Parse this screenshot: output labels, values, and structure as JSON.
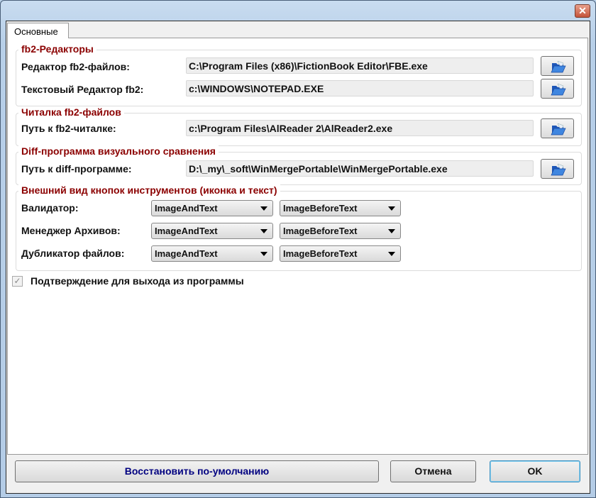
{
  "window": {
    "close_label": "✕"
  },
  "tabs": [
    {
      "label": "Основные"
    }
  ],
  "editors": {
    "title": "fb2-Редакторы",
    "fb2_editor": {
      "label": "Редактор fb2-файлов:",
      "value": "C:\\Program Files (x86)\\FictionBook Editor\\FBE.exe"
    },
    "text_editor": {
      "label": "Текстовый Редактор fb2:",
      "value": "c:\\WINDOWS\\NOTEPAD.EXE"
    }
  },
  "reader": {
    "title": "Читалка fb2-файлов",
    "label": "Путь к fb2-читалке:",
    "value": "c:\\Program Files\\AlReader 2\\AlReader2.exe"
  },
  "diff": {
    "title": "Diff-программа визуального сравнения",
    "label": "Путь к diff-программе:",
    "value": "D:\\_my\\_soft\\WinMergePortable\\WinMergePortable.exe"
  },
  "toolbar_look": {
    "title": "Внешний вид кнопок инструментов (иконка и текст)",
    "rows": [
      {
        "label": "Валидатор:",
        "mode": "ImageAndText",
        "relation": "ImageBeforeText"
      },
      {
        "label": "Менеджер Архивов:",
        "mode": "ImageAndText",
        "relation": "ImageBeforeText"
      },
      {
        "label": "Дубликатор файлов:",
        "mode": "ImageAndText",
        "relation": "ImageBeforeText"
      }
    ]
  },
  "confirm_exit": {
    "label": "Подтверждение для выхода из программы",
    "checked": true,
    "mark": "✓"
  },
  "buttons": {
    "restore": "Восстановить по-умолчанию",
    "cancel": "Отмена",
    "ok": "OK"
  },
  "colors": {
    "group_title": "#8b0000",
    "restore_text": "#000080"
  }
}
